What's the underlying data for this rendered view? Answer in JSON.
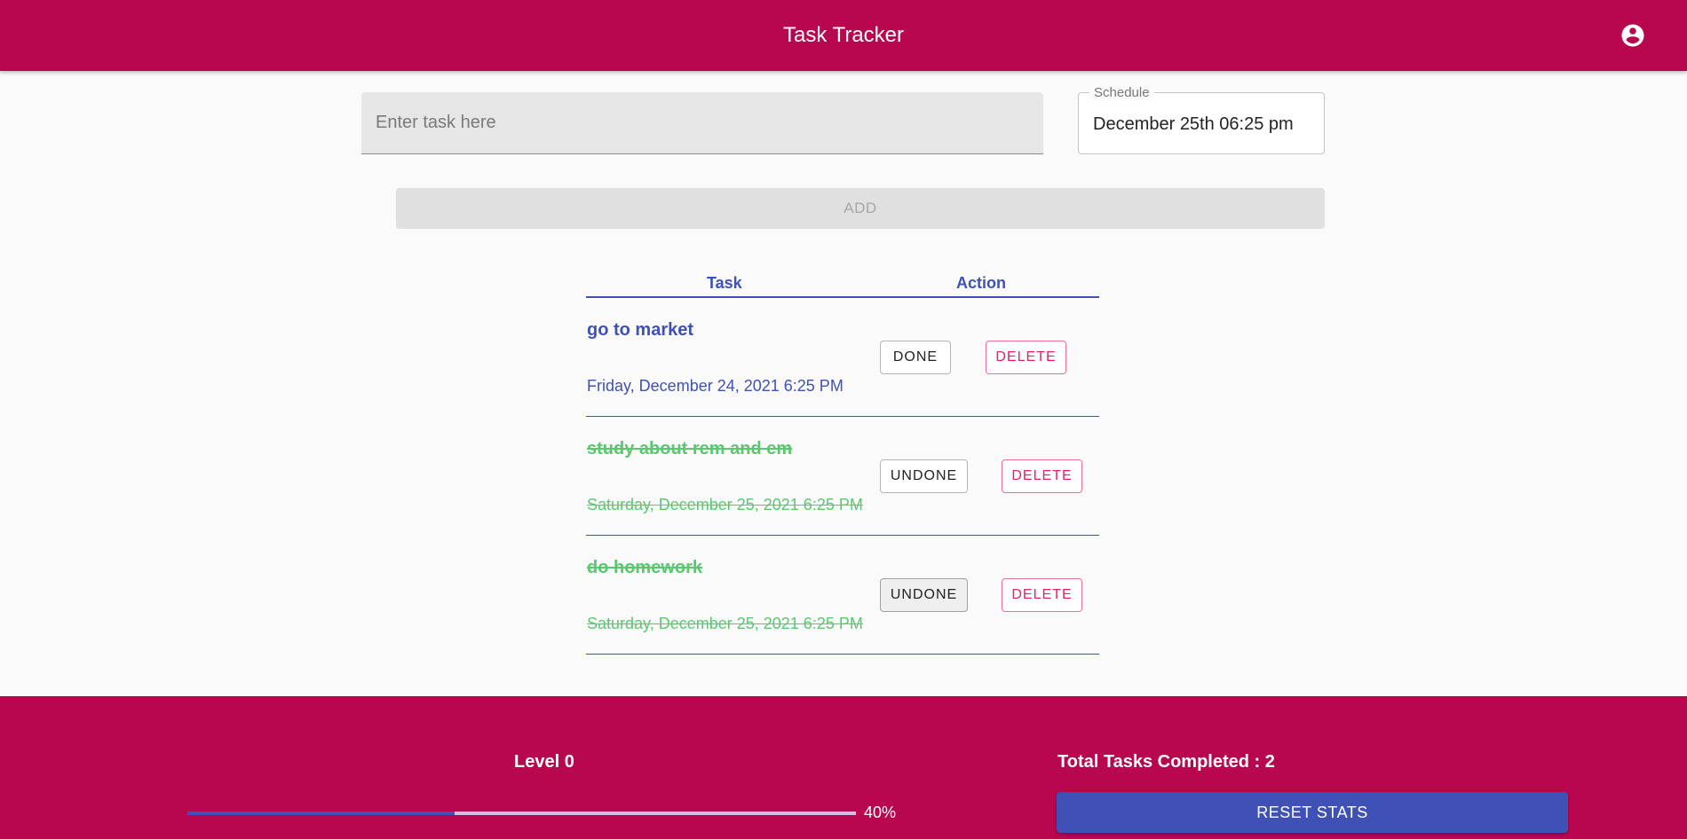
{
  "header": {
    "title": "Task Tracker",
    "account_icon": "account-circle-icon"
  },
  "form": {
    "task_placeholder": "Enter task here",
    "task_value": "",
    "schedule_label": "Schedule",
    "schedule_value": "December 25th 06:25 pm",
    "add_label": "ADD"
  },
  "table": {
    "headers": {
      "task": "Task",
      "action": "Action"
    },
    "rows": [
      {
        "name": "go to market",
        "date": "Friday, December 24, 2021 6:25 PM",
        "status": "pending",
        "toggle_label": "DONE",
        "delete_label": "DELETE"
      },
      {
        "name": "study about rem and em",
        "date": "Saturday, December 25, 2021 6:25 PM",
        "status": "done",
        "toggle_label": "UNDONE",
        "delete_label": "DELETE"
      },
      {
        "name": "do homework",
        "date": "Saturday, December 25, 2021 6:25 PM",
        "status": "done",
        "toggle_label": "UNDONE",
        "delete_label": "DELETE"
      }
    ]
  },
  "footer": {
    "level_label": "Level 0",
    "progress_percent": 40,
    "progress_text": "40%",
    "total_completed_label": "Total Tasks Completed : 2",
    "reset_label": "RESET STATS"
  },
  "colors": {
    "primary": "#b8074f",
    "accent": "#3f51b5",
    "done_text": "#5ac86e",
    "delete": "#e91e63"
  }
}
